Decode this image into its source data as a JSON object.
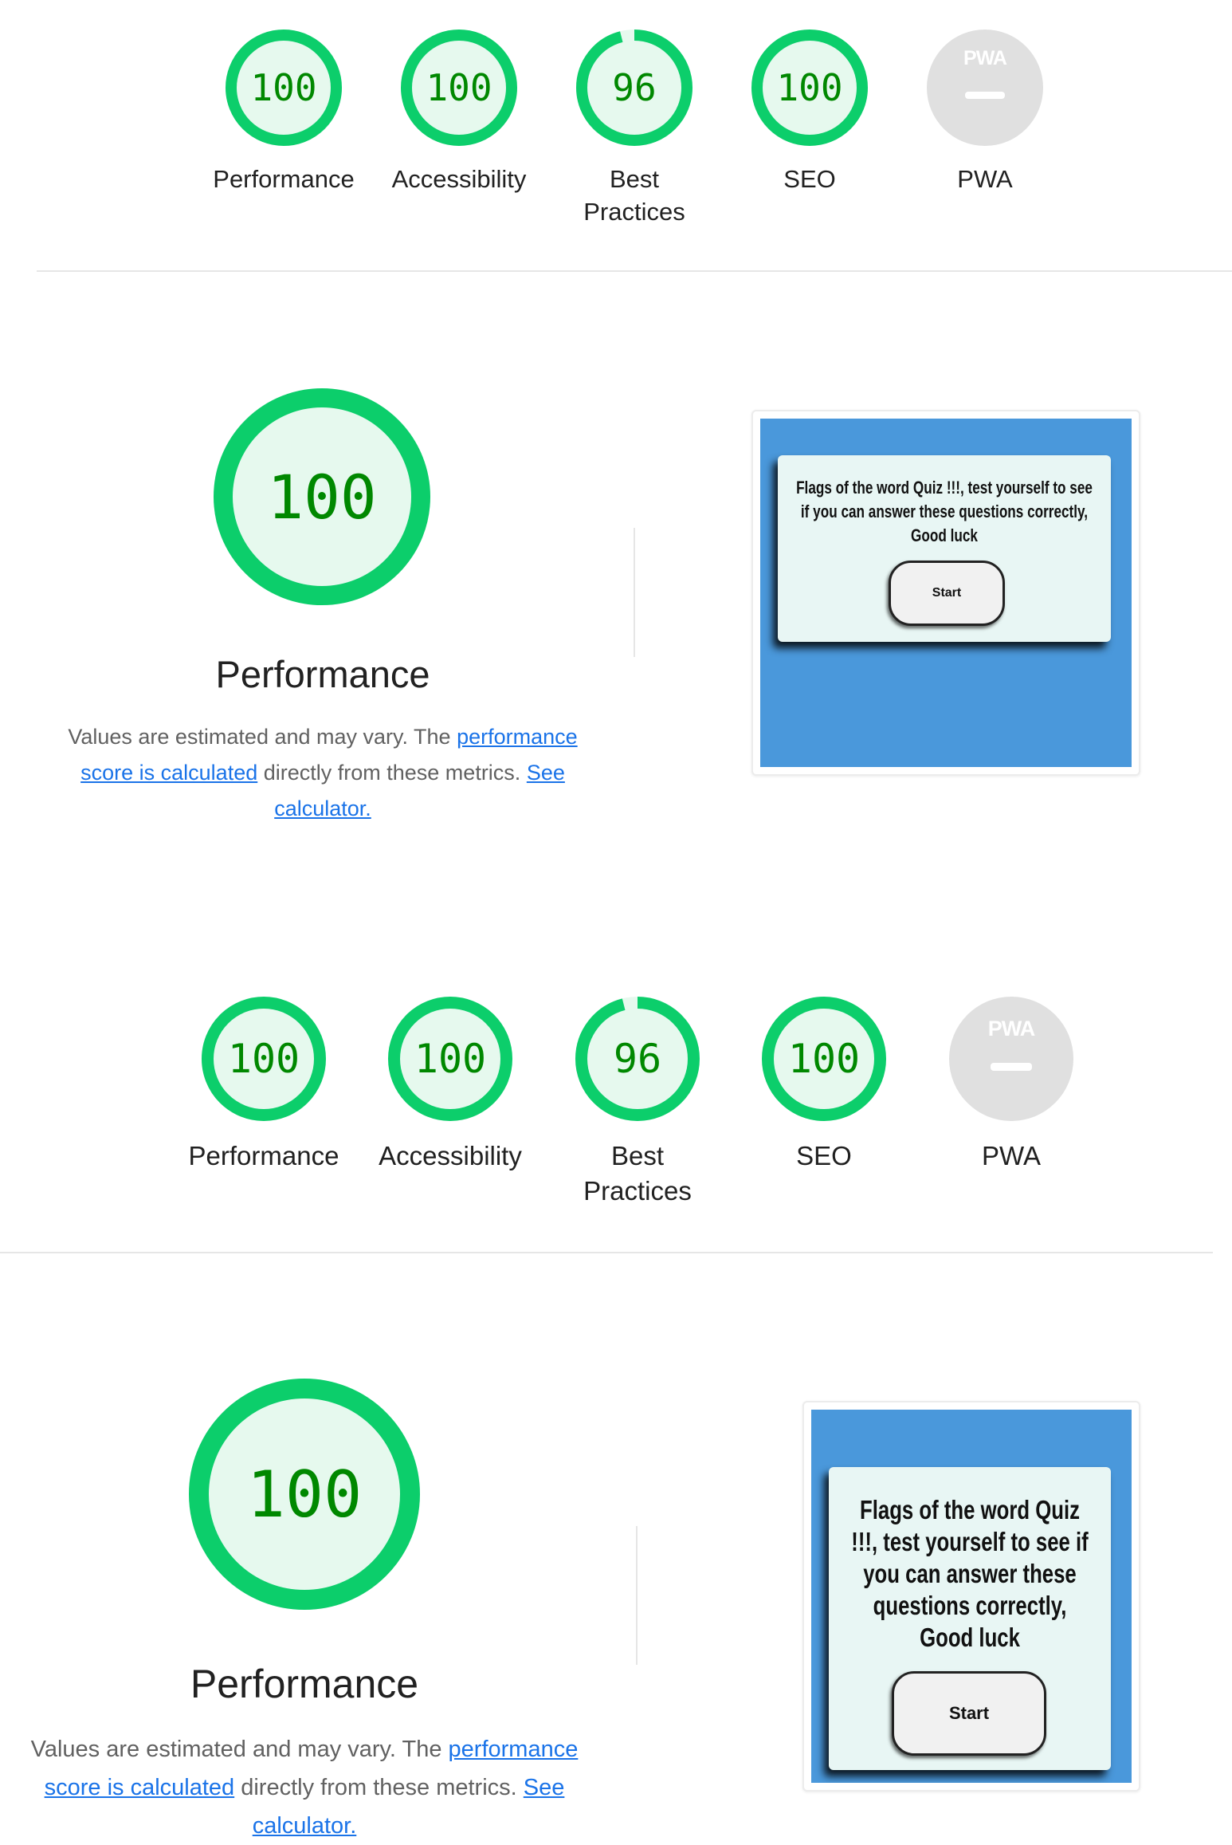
{
  "summary_top": {
    "gauges": [
      {
        "score": "100",
        "fraction": 1.0,
        "label": "Performance"
      },
      {
        "score": "100",
        "fraction": 1.0,
        "label": "Accessibility"
      },
      {
        "score": "96",
        "fraction": 0.96,
        "label": "Best Practices"
      },
      {
        "score": "100",
        "fraction": 1.0,
        "label": "SEO"
      }
    ],
    "pwa": {
      "badge_text": "PWA",
      "label": "PWA"
    }
  },
  "perf_top": {
    "score": "100",
    "fraction": 1.0,
    "title": "Performance",
    "desc_prefix": "Values are estimated and may vary. The ",
    "link_score": "performance score is calculated",
    "desc_middle": " directly from these metrics. ",
    "link_calc": "See calculator.",
    "screenshot": {
      "quiz_text": "Flags of the word Quiz !!!, test yourself to see if you can answer these questions correctly, Good luck",
      "button": "Start"
    }
  },
  "summary_bottom": {
    "gauges": [
      {
        "score": "100",
        "fraction": 1.0,
        "label": "Performance"
      },
      {
        "score": "100",
        "fraction": 1.0,
        "label": "Accessibility"
      },
      {
        "score": "96",
        "fraction": 0.96,
        "label": "Best Practices"
      },
      {
        "score": "100",
        "fraction": 1.0,
        "label": "SEO"
      }
    ],
    "pwa": {
      "badge_text": "PWA",
      "label": "PWA"
    }
  },
  "perf_bottom": {
    "score": "100",
    "fraction": 1.0,
    "title": "Performance",
    "desc_prefix": "Values are estimated and may vary. The ",
    "link_score": "performance score is calculated",
    "desc_middle": " directly from these metrics. ",
    "link_calc": "See calculator.",
    "screenshot": {
      "quiz_text": "Flags of the word Quiz !!!, test yourself to see if you can answer these questions correctly, Good luck",
      "button": "Start"
    }
  },
  "colors": {
    "pass_ring": "#0cce6b",
    "pass_fill": "#e6f9ee",
    "pass_text": "#008800",
    "link": "#1a73e8",
    "screenshot_bg": "#4a98db",
    "pwa_gray": "#e0e0e0"
  }
}
